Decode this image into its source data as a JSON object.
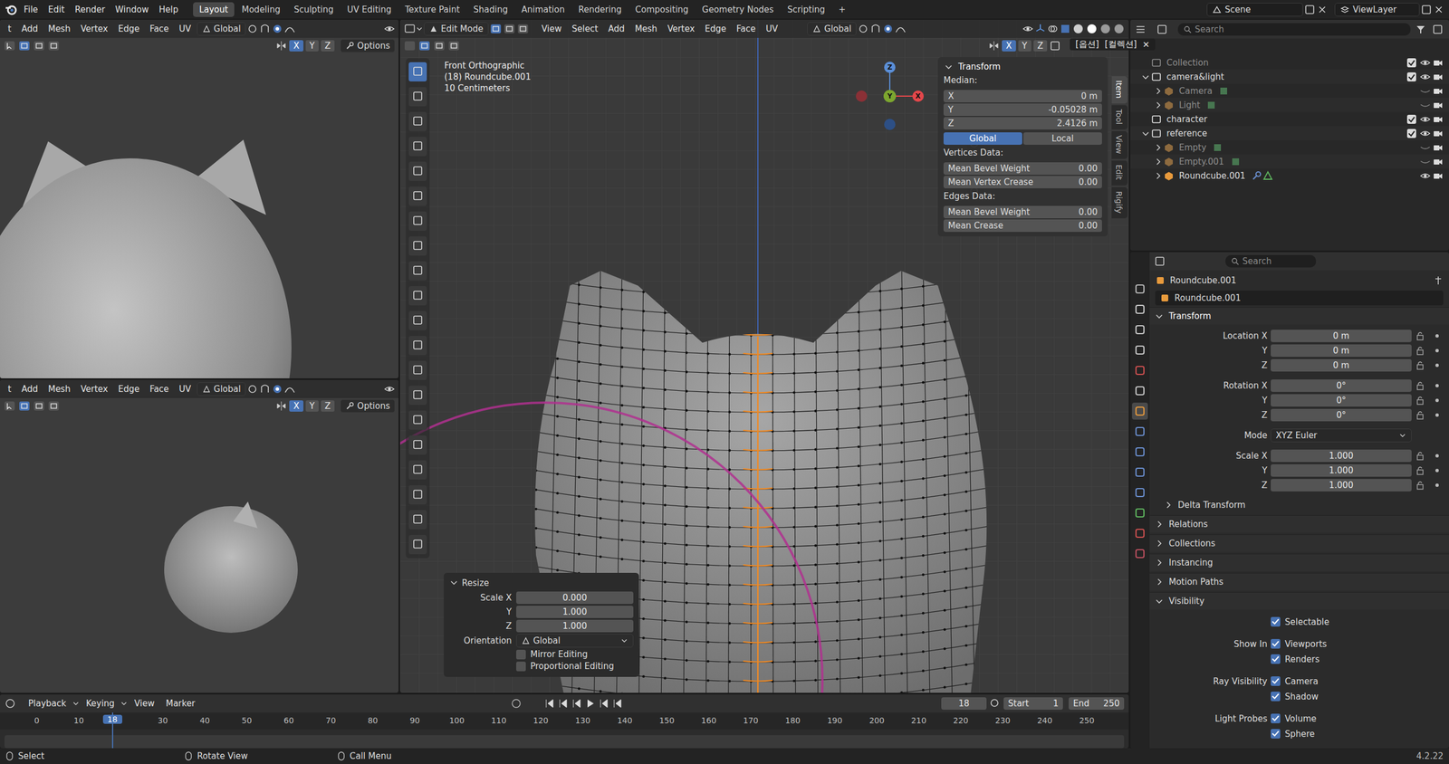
{
  "topbar": {
    "menus": [
      "File",
      "Edit",
      "Render",
      "Window",
      "Help"
    ],
    "workspaces": [
      {
        "label": "Layout",
        "selected": true
      },
      {
        "label": "Modeling",
        "selected": false
      },
      {
        "label": "Sculpting",
        "selected": false
      },
      {
        "label": "UV Editing",
        "selected": false
      },
      {
        "label": "Texture Paint",
        "selected": false
      },
      {
        "label": "Shading",
        "selected": false
      },
      {
        "label": "Animation",
        "selected": false
      },
      {
        "label": "Rendering",
        "selected": false
      },
      {
        "label": "Compositing",
        "selected": false
      },
      {
        "label": "Geometry Nodes",
        "selected": false
      },
      {
        "label": "Scripting",
        "selected": false
      }
    ],
    "add_workspace": "+",
    "scene": "Scene",
    "view_layer": "ViewLayer"
  },
  "left_top_view": {
    "menus": [
      "t",
      "Add",
      "Mesh",
      "Vertex",
      "Edge",
      "Face",
      "UV"
    ],
    "orientation": "Global",
    "axes": [
      {
        "label": "X",
        "selected": true
      },
      {
        "label": "Y",
        "selected": false
      },
      {
        "label": "Z",
        "selected": false
      }
    ],
    "options": "Options"
  },
  "left_bottom_view": {
    "menus": [
      "t",
      "Add",
      "Mesh",
      "Vertex",
      "Edge",
      "Face",
      "UV"
    ],
    "orientation": "Global",
    "axes": [
      {
        "label": "X",
        "selected": true
      },
      {
        "label": "Y",
        "selected": false
      },
      {
        "label": "Z",
        "selected": false
      }
    ],
    "options": "Options"
  },
  "main_view": {
    "mode": "Edit Mode",
    "menus": [
      "View",
      "Select",
      "Add",
      "Mesh",
      "Vertex",
      "Edge",
      "Face",
      "UV"
    ],
    "orientation": "Global",
    "axes": [
      {
        "label": "X",
        "selected": true
      },
      {
        "label": "Y",
        "selected": false
      },
      {
        "label": "Z",
        "selected": false
      }
    ],
    "info": [
      "Front Orthographic",
      "(18) Roundcube.001",
      "10 Centimeters"
    ],
    "gizmo": {
      "z": "Z",
      "y": "Y",
      "x": "X"
    },
    "sidebar_tabs": [
      {
        "label": "Item",
        "selected": true
      },
      {
        "label": "Tool",
        "selected": false
      },
      {
        "label": "View",
        "selected": false
      },
      {
        "label": "Edit",
        "selected": false
      },
      {
        "label": "Rigify",
        "selected": false
      }
    ],
    "transform": {
      "title": "Transform",
      "median": "Median:",
      "coords": [
        {
          "axis": "X",
          "value": "0 m"
        },
        {
          "axis": "Y",
          "value": "-0.05028 m"
        },
        {
          "axis": "Z",
          "value": "2.4126 m"
        }
      ],
      "spaces": [
        {
          "label": "Global",
          "selected": true
        },
        {
          "label": "Local",
          "selected": false
        }
      ],
      "vertices_title": "Vertices Data:",
      "vertices": [
        {
          "label": "Mean Bevel Weight",
          "value": "0.00"
        },
        {
          "label": "Mean Vertex Crease",
          "value": "0.00"
        }
      ],
      "edges_title": "Edges Data:",
      "edges": [
        {
          "label": "Mean Bevel Weight",
          "value": "0.00"
        },
        {
          "label": "Mean Crease",
          "value": "0.00"
        }
      ]
    },
    "resize": {
      "title": "Resize",
      "scale": [
        {
          "label": "Scale X",
          "value": "0.000"
        },
        {
          "label": "Y",
          "value": "1.000"
        },
        {
          "label": "Z",
          "value": "1.000"
        }
      ],
      "orientation_label": "Orientation",
      "orientation": "Global",
      "options": [
        {
          "label": "Mirror Editing",
          "checked": false
        },
        {
          "label": "Proportional Editing",
          "checked": false
        }
      ]
    }
  },
  "ime_hint": {
    "left": "[옵션]",
    "right": "[컬렉션]",
    "close": "✕"
  },
  "outliner": {
    "search": "Search",
    "items": [
      {
        "label": "Collection",
        "kind": "collection",
        "greyed": true,
        "checked": true,
        "visible": true,
        "children": []
      },
      {
        "label": "camera&light",
        "kind": "collection",
        "greyed": false,
        "checked": true,
        "visible": true,
        "expanded": true,
        "children": [
          {
            "label": "Camera",
            "kind": "object",
            "greyed": true,
            "visible": false,
            "expanded": false,
            "color": "#e0a050"
          },
          {
            "label": "Light",
            "kind": "object",
            "greyed": true,
            "visible": false,
            "expanded": false,
            "color": "#e0a050"
          }
        ]
      },
      {
        "label": "character",
        "kind": "collection",
        "greyed": false,
        "checked": true,
        "visible": true,
        "children": []
      },
      {
        "label": "reference",
        "kind": "collection",
        "greyed": false,
        "checked": true,
        "visible": true,
        "expanded": true,
        "children": [
          {
            "label": "Empty",
            "kind": "object",
            "greyed": true,
            "visible": false,
            "expanded": false,
            "color": "#e0a050"
          },
          {
            "label": "Empty.001",
            "kind": "object",
            "greyed": true,
            "visible": false,
            "expanded": false,
            "color": "#e0a050"
          },
          {
            "label": "Roundcube.001",
            "kind": "object",
            "greyed": false,
            "visible": true,
            "expanded": false,
            "color": "#e89a3c"
          }
        ]
      }
    ]
  },
  "properties": {
    "search": "Search",
    "tabs": [
      {
        "color": "#b8b8b8",
        "selected": false
      },
      {
        "color": "#c9c9c9",
        "selected": false
      },
      {
        "color": "#c9c9c9",
        "selected": false
      },
      {
        "color": "#c9c9c9",
        "selected": false
      },
      {
        "color": "#d05050",
        "selected": false
      },
      {
        "color": "#c9c9c9",
        "selected": false
      },
      {
        "color": "#e89a3c",
        "selected": true
      },
      {
        "color": "#6a8fd0",
        "selected": false
      },
      {
        "color": "#6a8fd0",
        "selected": false
      },
      {
        "color": "#6a8fd0",
        "selected": false
      },
      {
        "color": "#6a8fd0",
        "selected": false
      },
      {
        "color": "#5fb85f",
        "selected": false
      },
      {
        "color": "#d05050",
        "selected": false
      },
      {
        "color": "#c05060",
        "selected": false
      }
    ],
    "object": "Roundcube.001",
    "name": "Roundcube.001",
    "transform_title": "Transform",
    "rows": [
      {
        "label": "Location X",
        "value": "0 m",
        "kind": "number"
      },
      {
        "label": "Y",
        "value": "0 m",
        "kind": "number"
      },
      {
        "label": "Z",
        "value": "0 m",
        "kind": "number"
      },
      {
        "label": "Rotation X",
        "value": "0°",
        "kind": "number"
      },
      {
        "label": "Y",
        "value": "0°",
        "kind": "number"
      },
      {
        "label": "Z",
        "value": "0°",
        "kind": "number"
      },
      {
        "label": "Mode",
        "value": "XYZ Euler",
        "kind": "dropdown"
      },
      {
        "label": "Scale X",
        "value": "1.000",
        "kind": "number"
      },
      {
        "label": "Y",
        "value": "1.000",
        "kind": "number"
      },
      {
        "label": "Z",
        "value": "1.000",
        "kind": "number"
      }
    ],
    "sections": [
      {
        "label": "Delta Transform",
        "expanded": false,
        "kind": "sub"
      },
      {
        "label": "Relations",
        "expanded": false,
        "kind": "main"
      },
      {
        "label": "Collections",
        "expanded": false,
        "kind": "main"
      },
      {
        "label": "Instancing",
        "expanded": false,
        "kind": "main"
      },
      {
        "label": "Motion Paths",
        "expanded": false,
        "kind": "main"
      },
      {
        "label": "Visibility",
        "expanded": true,
        "kind": "main"
      }
    ],
    "visibility": [
      {
        "group": "",
        "items": [
          {
            "label": "Selectable",
            "checked": true
          }
        ]
      },
      {
        "group": "Show In",
        "items": [
          {
            "label": "Viewports",
            "checked": true
          },
          {
            "label": "Renders",
            "checked": true
          }
        ]
      },
      {
        "group": "Ray Visibility",
        "items": [
          {
            "label": "Camera",
            "checked": true
          },
          {
            "label": "Shadow",
            "checked": true
          }
        ]
      },
      {
        "group": "Light Probes",
        "items": [
          {
            "label": "Volume",
            "checked": true
          },
          {
            "label": "Sphere",
            "checked": true
          }
        ]
      }
    ]
  },
  "timeline": {
    "menus": [
      "Playback",
      "Keying",
      "View",
      "Marker"
    ],
    "current_frame": "18",
    "start_label": "Start",
    "start": "1",
    "end_label": "End",
    "end": "250",
    "ruler": [
      "0",
      "10",
      "30",
      "40",
      "50",
      "60",
      "70",
      "80",
      "90",
      "100",
      "110",
      "120",
      "130",
      "140",
      "150",
      "160",
      "170",
      "180",
      "190",
      "200",
      "210",
      "220",
      "230",
      "240",
      "250"
    ],
    "marker": "18"
  },
  "status_bar": {
    "hints": [
      "Select",
      "Rotate View",
      "Call Menu"
    ],
    "version": "4.2.22"
  }
}
